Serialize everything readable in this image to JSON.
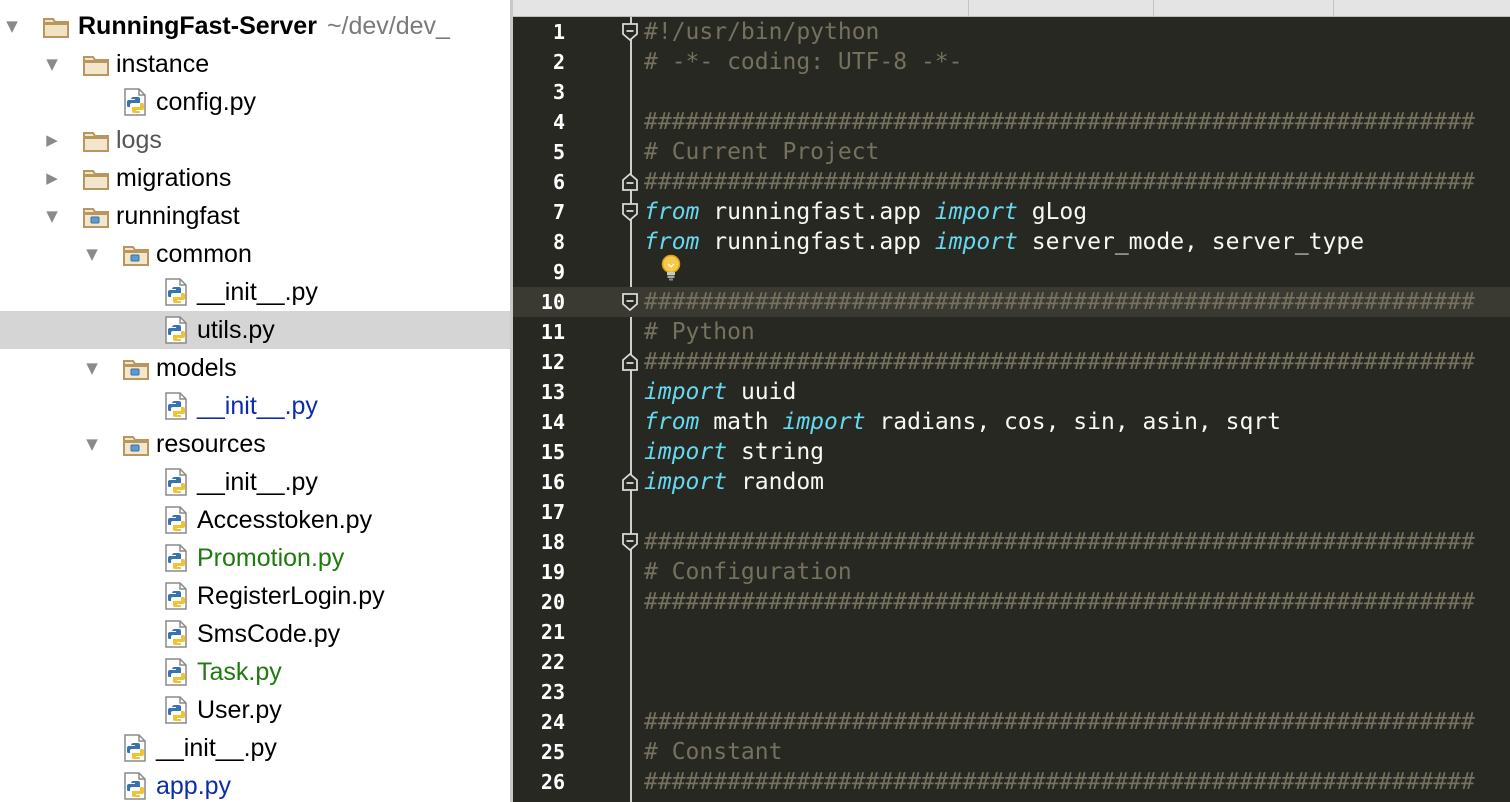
{
  "window": {
    "project_tree": {
      "root": {
        "label": "RunningFast-Server",
        "path": "~/dev/dev_"
      },
      "items": [
        {
          "label": "instance",
          "type": "folder",
          "depth": 1,
          "expanded": true
        },
        {
          "label": "config.py",
          "type": "python-file",
          "depth": 2
        },
        {
          "label": "logs",
          "type": "folder",
          "depth": 1,
          "expanded": false
        },
        {
          "label": "migrations",
          "type": "folder",
          "depth": 1,
          "expanded": false
        },
        {
          "label": "runningfast",
          "type": "package",
          "depth": 1,
          "expanded": true
        },
        {
          "label": "common",
          "type": "package",
          "depth": 2,
          "expanded": true
        },
        {
          "label": "__init__.py",
          "type": "python-file",
          "depth": 3
        },
        {
          "label": "utils.py",
          "type": "python-file",
          "depth": 3,
          "selected": true
        },
        {
          "label": "models",
          "type": "package",
          "depth": 2,
          "expanded": true
        },
        {
          "label": "__init__.py",
          "type": "python-file",
          "depth": 3,
          "status": "modified"
        },
        {
          "label": "resources",
          "type": "package",
          "depth": 2,
          "expanded": true
        },
        {
          "label": "__init__.py",
          "type": "python-file",
          "depth": 3
        },
        {
          "label": "Accesstoken.py",
          "type": "python-file",
          "depth": 3
        },
        {
          "label": "Promotion.py",
          "type": "python-file",
          "depth": 3,
          "status": "added"
        },
        {
          "label": "RegisterLogin.py",
          "type": "python-file",
          "depth": 3
        },
        {
          "label": "SmsCode.py",
          "type": "python-file",
          "depth": 3
        },
        {
          "label": "Task.py",
          "type": "python-file",
          "depth": 3,
          "status": "added"
        },
        {
          "label": "User.py",
          "type": "python-file",
          "depth": 3
        },
        {
          "label": "__init__.py",
          "type": "python-file",
          "depth": 2
        },
        {
          "label": "app.py",
          "type": "python-file",
          "depth": 2,
          "status": "modified"
        }
      ]
    },
    "editor": {
      "current_line": 10,
      "lines": [
        {
          "n": "1",
          "tokens": [
            [
              "comment",
              "#!/usr/bin/python"
            ]
          ],
          "fold": "start"
        },
        {
          "n": "2",
          "tokens": [
            [
              "comment",
              "# -*- coding: UTF-8 -*-"
            ]
          ]
        },
        {
          "n": "3",
          "tokens": []
        },
        {
          "n": "4",
          "tokens": [
            [
              "comment",
              "############################################################"
            ]
          ]
        },
        {
          "n": "5",
          "tokens": [
            [
              "comment",
              "# Current Project"
            ]
          ]
        },
        {
          "n": "6",
          "tokens": [
            [
              "comment",
              "############################################################"
            ]
          ],
          "fold": "end"
        },
        {
          "n": "7",
          "tokens": [
            [
              "kw",
              "from"
            ],
            [
              "plain",
              " runningfast.app "
            ],
            [
              "kw",
              "import"
            ],
            [
              "plain",
              " gLog"
            ]
          ],
          "fold": "start"
        },
        {
          "n": "8",
          "tokens": [
            [
              "kw",
              "from"
            ],
            [
              "plain",
              " runningfast.app "
            ],
            [
              "kw",
              "import"
            ],
            [
              "plain",
              " server_mode, server_type"
            ]
          ]
        },
        {
          "n": "9",
          "tokens": []
        },
        {
          "n": "10",
          "tokens": [
            [
              "comment",
              "############################################################"
            ]
          ],
          "fold": "start"
        },
        {
          "n": "11",
          "tokens": [
            [
              "comment",
              "# Python"
            ]
          ]
        },
        {
          "n": "12",
          "tokens": [
            [
              "comment",
              "############################################################"
            ]
          ],
          "fold": "end"
        },
        {
          "n": "13",
          "tokens": [
            [
              "kw",
              "import"
            ],
            [
              "plain",
              " uuid"
            ]
          ]
        },
        {
          "n": "14",
          "tokens": [
            [
              "kw",
              "from"
            ],
            [
              "plain",
              " math "
            ],
            [
              "kw",
              "import"
            ],
            [
              "plain",
              " radians, cos, sin, asin, sqrt"
            ]
          ]
        },
        {
          "n": "15",
          "tokens": [
            [
              "kw",
              "import"
            ],
            [
              "plain",
              " string"
            ]
          ]
        },
        {
          "n": "16",
          "tokens": [
            [
              "kw",
              "import"
            ],
            [
              "plain",
              " random"
            ]
          ],
          "fold": "end"
        },
        {
          "n": "17",
          "tokens": []
        },
        {
          "n": "18",
          "tokens": [
            [
              "comment",
              "############################################################"
            ]
          ],
          "fold": "start"
        },
        {
          "n": "19",
          "tokens": [
            [
              "comment",
              "# Configuration"
            ]
          ]
        },
        {
          "n": "20",
          "tokens": [
            [
              "comment",
              "############################################################"
            ]
          ]
        },
        {
          "n": "21",
          "tokens": []
        },
        {
          "n": "22",
          "tokens": []
        },
        {
          "n": "23",
          "tokens": []
        },
        {
          "n": "24",
          "tokens": [
            [
              "comment",
              "############################################################"
            ]
          ]
        },
        {
          "n": "25",
          "tokens": [
            [
              "comment",
              "# Constant"
            ]
          ]
        },
        {
          "n": "26",
          "tokens": [
            [
              "comment",
              "############################################################"
            ]
          ]
        }
      ],
      "intention_bulb_line": 9
    },
    "colors": {
      "editor_bg": "#272822",
      "comment": "#75715e",
      "keyword": "#66d9ef",
      "text": "#f8f8f2",
      "current_line": "#3b3a32",
      "tree_selected": "#d5d5d5",
      "vcs_modified": "#0b2ea8",
      "vcs_added": "#1e7a0e",
      "folder": "#b8975e"
    },
    "icons": {
      "folder": "folder-icon",
      "package": "package-folder-icon",
      "python": "python-file-icon",
      "expanded": "triangle-down-icon",
      "collapsed": "triangle-right-icon",
      "bulb": "lightbulb-icon",
      "fold": "fold-marker-icon"
    }
  }
}
